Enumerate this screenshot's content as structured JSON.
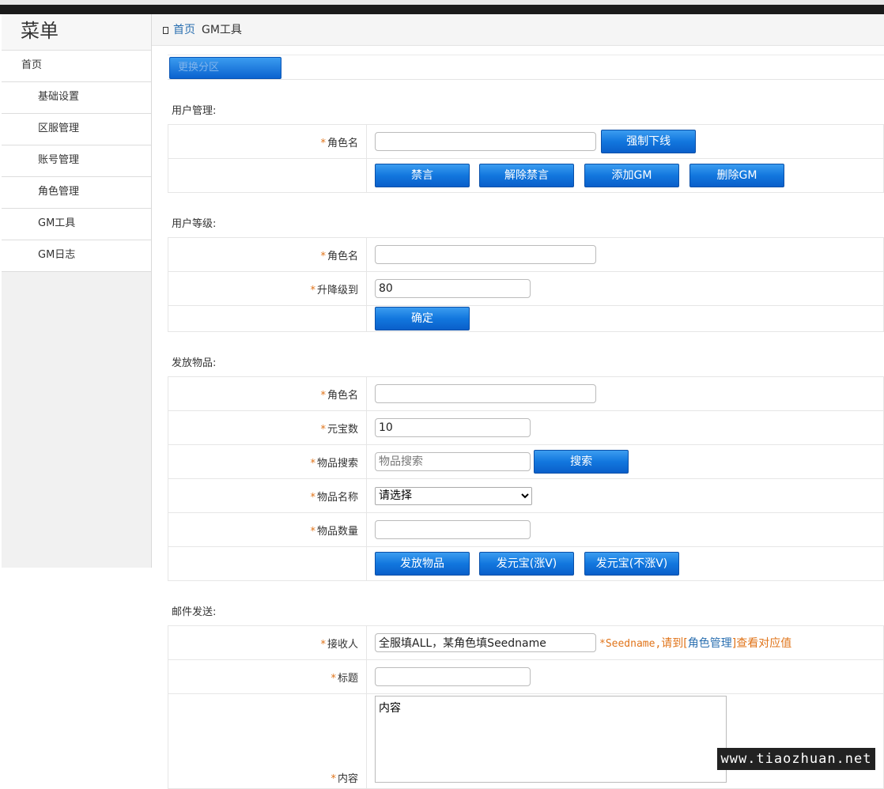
{
  "sidebar": {
    "title": "菜单",
    "home": "首页",
    "items": [
      "基础设置",
      "区服管理",
      "账号管理",
      "角色管理",
      "GM工具",
      "GM日志"
    ]
  },
  "breadcrumb": {
    "home": "首页",
    "current": "GM工具"
  },
  "zone_button": "更换分区",
  "user_mgmt": {
    "title": "用户管理:",
    "role_label": "角色名",
    "role_value": "",
    "kick_button": "强制下线",
    "buttons": [
      "禁言",
      "解除禁言",
      "添加GM",
      "删除GM"
    ]
  },
  "user_level": {
    "title": "用户等级:",
    "role_label": "角色名",
    "role_value": "",
    "level_label": "升降级到",
    "level_value": "80",
    "confirm_button": "确定"
  },
  "items": {
    "title": "发放物品:",
    "role_label": "角色名",
    "role_value": "",
    "gold_label": "元宝数",
    "gold_value": "10",
    "search_label": "物品搜索",
    "search_placeholder": "物品搜索",
    "search_button": "搜索",
    "name_label": "物品名称",
    "name_selected": "请选择",
    "qty_label": "物品数量",
    "qty_value": "",
    "buttons": [
      "发放物品",
      "发元宝(涨V)",
      "发元宝(不涨V)"
    ]
  },
  "mail": {
    "title": "邮件发送:",
    "receiver_label": "接收人",
    "receiver_value": "全服填ALL，某角色填Seedname",
    "hint_prefix": "*Seedname,",
    "hint_mid": "请到[",
    "hint_link": "角色管理",
    "hint_suffix": "]查看对应值",
    "subject_label": "标题",
    "subject_value": "",
    "content_label": "内容",
    "content_value": "内容"
  },
  "watermark": "www.tiaozhuan.net",
  "required_mark": "*"
}
